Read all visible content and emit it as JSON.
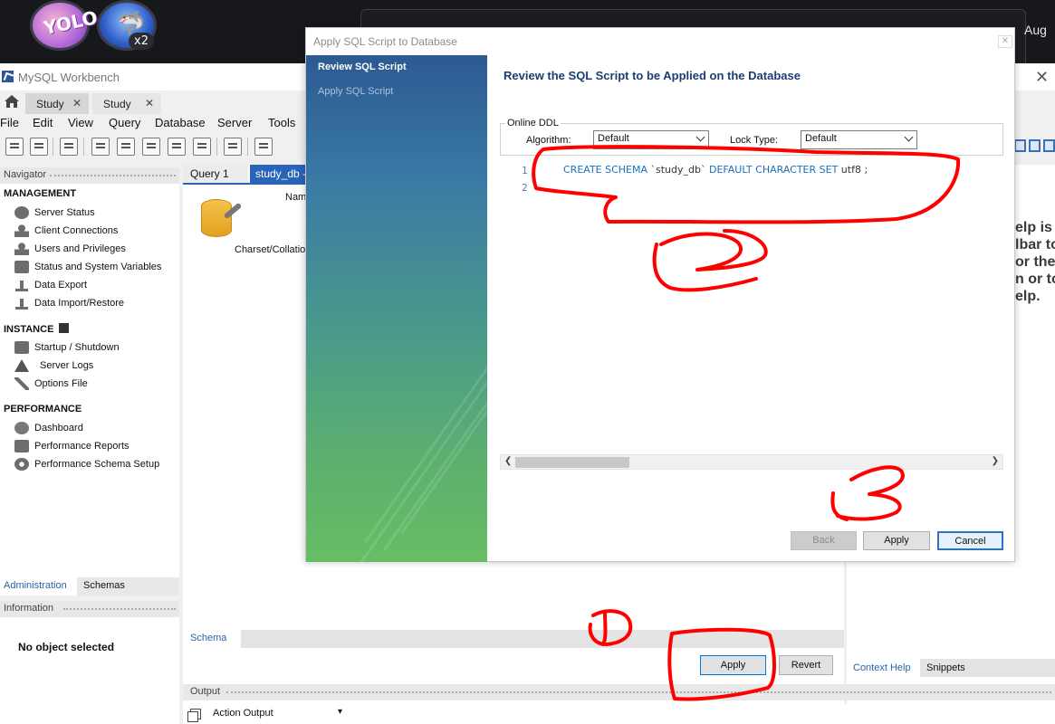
{
  "desktop": {
    "avatar_badge": "x2",
    "avatar1_text": "YOLO",
    "clock_partial": "Aug"
  },
  "window": {
    "title": "MySQL Workbench",
    "tabs": [
      {
        "label": "Study"
      },
      {
        "label": "Study"
      }
    ]
  },
  "menu": [
    "File",
    "Edit",
    "View",
    "Query",
    "Database",
    "Server",
    "Tools"
  ],
  "navigator": {
    "header": "Navigator",
    "management_title": "MANAGEMENT",
    "management": [
      {
        "label": "Server Status",
        "icon": "play-circle-icon"
      },
      {
        "label": "Client Connections",
        "icon": "client-icon"
      },
      {
        "label": "Users and Privileges",
        "icon": "user-icon"
      },
      {
        "label": "Status and System Variables",
        "icon": "monitor-icon"
      },
      {
        "label": "Data Export",
        "icon": "upload-icon"
      },
      {
        "label": "Data Import/Restore",
        "icon": "download-icon"
      }
    ],
    "instance_title": "INSTANCE",
    "instance": [
      {
        "label": "Startup / Shutdown",
        "icon": "power-icon"
      },
      {
        "label": "Server Logs",
        "icon": "warning-icon"
      },
      {
        "label": "Options File",
        "icon": "wrench-icon"
      }
    ],
    "performance_title": "PERFORMANCE",
    "performance": [
      {
        "label": "Dashboard",
        "icon": "gauge-icon"
      },
      {
        "label": "Performance Reports",
        "icon": "reports-icon"
      },
      {
        "label": "Performance Schema Setup",
        "icon": "gear-icon"
      }
    ],
    "bottom_tabs": {
      "administration": "Administration",
      "schemas": "Schemas"
    }
  },
  "information": {
    "header": "Information",
    "text": "No object selected"
  },
  "editor": {
    "query_tab": "Query 1",
    "active_tab": "study_db -",
    "name_label": "Nam",
    "charset_label": "Charset/Collatio",
    "schema_tab": "Schema",
    "apply": "Apply",
    "revert": "Revert"
  },
  "right_panel": {
    "help_lines": [
      "elp is",
      "lbar to",
      "or the",
      "n or to",
      "elp."
    ],
    "context_help": "Context Help",
    "snippets": "Snippets"
  },
  "output": {
    "header": "Output",
    "select": "Action Output"
  },
  "dialog": {
    "title": "Apply SQL Script to Database",
    "steps": [
      {
        "label": "Review SQL Script",
        "active": true
      },
      {
        "label": "Apply SQL Script",
        "active": false
      }
    ],
    "heading": "Review the SQL Script to be Applied on the Database",
    "online_ddl": "Online DDL",
    "algorithm_label": "Algorithm:",
    "algorithm_value": "Default",
    "lock_label": "Lock Type:",
    "lock_value": "Default",
    "line_numbers": [
      "1",
      "2"
    ],
    "sql": {
      "kw1": "CREATE SCHEMA",
      "name": "`study_db`",
      "kw2": "DEFAULT CHARACTER SET",
      "value": "utf8 ;"
    },
    "buttons": {
      "back": "Back",
      "apply": "Apply",
      "cancel": "Cancel"
    }
  },
  "colors": {
    "accent": "#2a64b8",
    "annotation": "#ff0000",
    "dialog_heading": "#1a3e72"
  }
}
